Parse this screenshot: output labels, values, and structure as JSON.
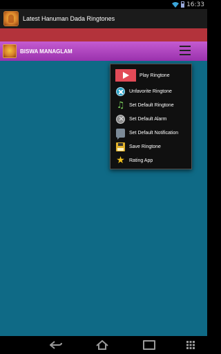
{
  "status_bar": {
    "time": "16:33"
  },
  "app_bar": {
    "title": "Latest Hanuman Dada Ringtones"
  },
  "toolbar": {
    "song_title": "BISWA MANAGLAM"
  },
  "popup_menu": {
    "items": [
      {
        "label": "Play Ringtone",
        "icon": "play-icon"
      },
      {
        "label": "Unfavorite Ringtone",
        "icon": "unfavorite-icon"
      },
      {
        "label": "Set Default Ringtone",
        "icon": "music-note-icon"
      },
      {
        "label": "Set Default Alarm",
        "icon": "alarm-icon"
      },
      {
        "label": "Set Default Notification",
        "icon": "notification-icon"
      },
      {
        "label": "Save Ringtone",
        "icon": "save-icon"
      },
      {
        "label": "Rating App",
        "icon": "star-icon"
      }
    ]
  },
  "colors": {
    "red_band": "#b3333b",
    "toolbar_purple": "#b047c0",
    "content_background": "#0f6a86",
    "play_button": "#e24a57"
  }
}
